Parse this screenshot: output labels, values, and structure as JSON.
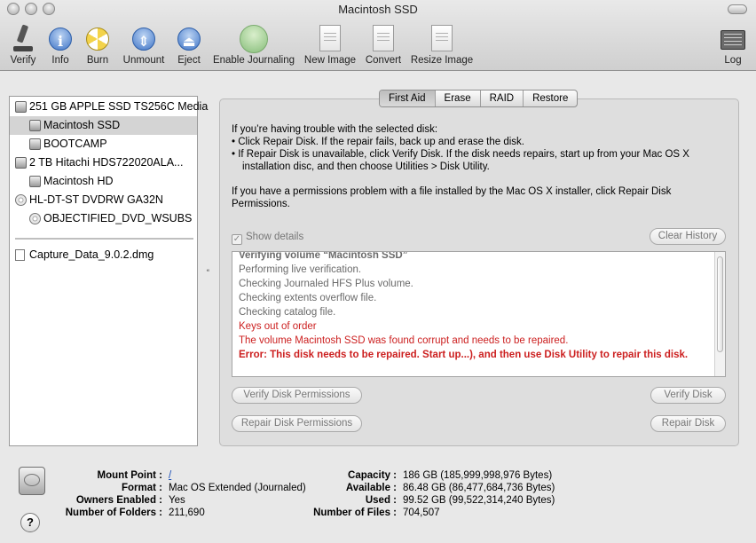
{
  "window": {
    "title": "Macintosh SSD"
  },
  "toolbar": {
    "verify": "Verify",
    "info": "Info",
    "burn": "Burn",
    "unmount": "Unmount",
    "eject": "Eject",
    "enable_journaling": "Enable Journaling",
    "new_image": "New Image",
    "convert": "Convert",
    "resize_image": "Resize Image",
    "log": "Log"
  },
  "sidebar": {
    "items": [
      {
        "label": "251 GB APPLE SSD TS256C Media",
        "icon": "disk-icon"
      },
      {
        "label": "Macintosh SSD",
        "icon": "disk-icon"
      },
      {
        "label": "BOOTCAMP",
        "icon": "disk-icon"
      },
      {
        "label": "2 TB Hitachi HDS722020ALA...",
        "icon": "disk-icon"
      },
      {
        "label": "Macintosh HD",
        "icon": "disk-icon"
      },
      {
        "label": "HL-DT-ST DVDRW GA32N",
        "icon": "optical-disc-icon"
      },
      {
        "label": "OBJECTIFIED_DVD_WSUBS",
        "icon": "optical-disc-icon"
      }
    ],
    "images": [
      {
        "label": "Capture_Data_9.0.2.dmg",
        "icon": "dmg-file-icon"
      }
    ]
  },
  "tabs": {
    "first_aid": "First Aid",
    "erase": "Erase",
    "raid": "RAID",
    "restore": "Restore"
  },
  "first_aid": {
    "intro": "If you’re having trouble with the selected disk:",
    "bullet1": "• Click Repair Disk. If the repair fails, back up and erase the disk.",
    "bullet2a": "• If Repair Disk is unavailable, click Verify Disk. If the disk needs repairs, start up from your Mac OS X",
    "bullet2b": "installation disc, and then choose Utilities > Disk Utility.",
    "perm1": "If you have a permissions problem with a file installed by the Mac OS X installer, click Repair Disk",
    "perm2": "Permissions.",
    "show_details": "Show details",
    "clear_history": "Clear History",
    "log": [
      {
        "text": "Verifying volume “Macintosh SSD”",
        "style": "bold"
      },
      {
        "text": "Performing live verification.",
        "style": "normal"
      },
      {
        "text": "Checking Journaled HFS Plus volume.",
        "style": "normal"
      },
      {
        "text": "Checking extents overflow file.",
        "style": "normal"
      },
      {
        "text": "Checking catalog file.",
        "style": "normal"
      },
      {
        "text": "Keys out of order",
        "style": "red"
      },
      {
        "text": "The volume Macintosh SSD was found corrupt and needs to be repaired.",
        "style": "red"
      },
      {
        "text": "Error: This disk needs to be repaired. Start up...), and then use Disk Utility to repair this disk.",
        "style": "red-bold"
      }
    ],
    "verify_permissions": "Verify Disk Permissions",
    "verify_disk": "Verify Disk",
    "repair_permissions": "Repair Disk Permissions",
    "repair_disk": "Repair Disk"
  },
  "details": {
    "left": [
      {
        "key": "Mount Point :",
        "value": "/",
        "link": true
      },
      {
        "key": "Format :",
        "value": "Mac OS Extended (Journaled)"
      },
      {
        "key": "Owners Enabled :",
        "value": "Yes"
      },
      {
        "key": "Number of Folders :",
        "value": "211,690"
      }
    ],
    "right": [
      {
        "key": "Capacity :",
        "value": "186 GB (185,999,998,976 Bytes)"
      },
      {
        "key": "Available :",
        "value": "86.48 GB (86,477,684,736 Bytes)"
      },
      {
        "key": "Used :",
        "value": "99.52 GB (99,522,314,240 Bytes)"
      },
      {
        "key": "Number of Files :",
        "value": "704,507"
      }
    ],
    "help": "?"
  }
}
